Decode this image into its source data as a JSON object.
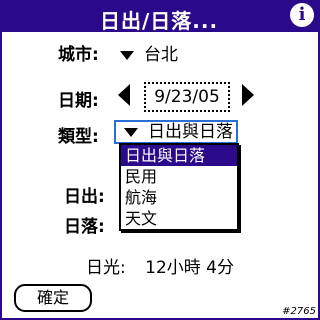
{
  "window": {
    "title": "日出/日落..."
  },
  "form": {
    "city_label": "城市:",
    "city_value": "台北",
    "date_label": "日期:",
    "date_value": "9/23/05",
    "type_label": "類型:",
    "type_value": "日出與日落",
    "sunrise_label": "日出:",
    "sunset_label": "日落:"
  },
  "dropdown": {
    "options": [
      "日出與日落",
      "民用",
      "航海",
      "天文"
    ],
    "selected_index": 0
  },
  "daylight": {
    "label": "日光:",
    "value": "12小時 4分"
  },
  "buttons": {
    "ok": "確定"
  },
  "footer": {
    "code": "#2765"
  },
  "colors": {
    "title_bar": "#2a0a8a",
    "focus_ring": "#2a6fd8",
    "selection": "#2a0a8a"
  }
}
